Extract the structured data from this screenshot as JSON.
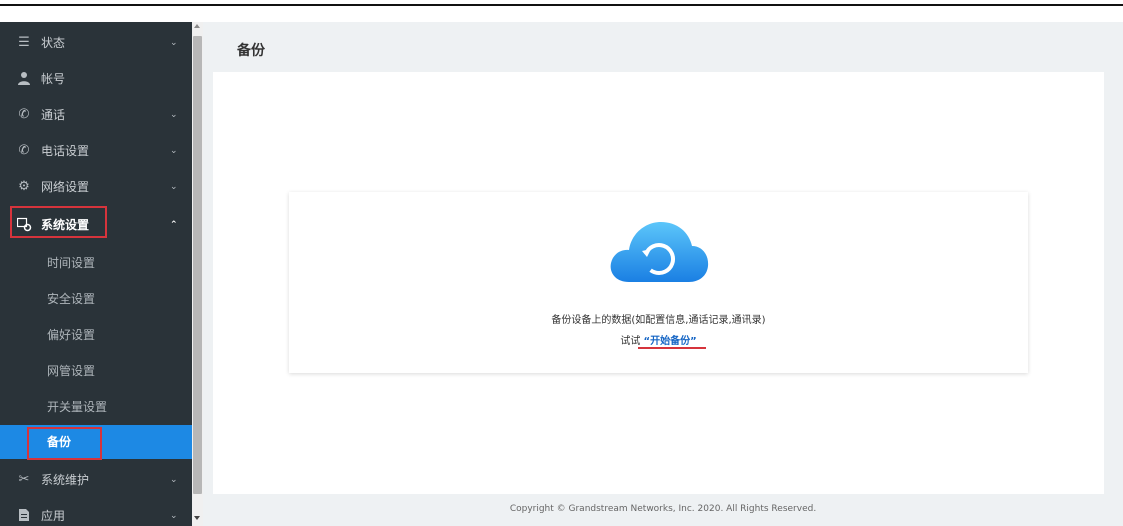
{
  "sidebar": {
    "items": [
      {
        "label": "状态",
        "icon": "list-icon",
        "chevron": "⌄"
      },
      {
        "label": "帐号",
        "icon": "user-icon",
        "chevron": ""
      },
      {
        "label": "通话",
        "icon": "phone-ringing-icon",
        "chevron": "⌄"
      },
      {
        "label": "电话设置",
        "icon": "phone-icon",
        "chevron": "⌄"
      },
      {
        "label": "网络设置",
        "icon": "network-icon",
        "chevron": "⌄"
      },
      {
        "label": "系统设置",
        "icon": "system-settings-icon",
        "chevron": "⌃"
      }
    ],
    "sub_items": [
      "时间设置",
      "安全设置",
      "偏好设置",
      "网管设置",
      "开关量设置",
      "备份"
    ],
    "after_items": [
      {
        "label": "系统维护",
        "icon": "tools-icon",
        "chevron": "⌄"
      },
      {
        "label": "应用",
        "icon": "document-icon",
        "chevron": "⌄"
      }
    ]
  },
  "main": {
    "title": "备份",
    "description": "备份设备上的数据(如配置信息,通话记录,通讯录)",
    "try_prefix": "试试",
    "try_link": "“开始备份”"
  },
  "footer": {
    "copyright": "Copyright © Grandstream Networks, Inc. 2020. All Rights Reserved."
  },
  "colors": {
    "sidebar_bg": "#2a3339",
    "active": "#1d89e4",
    "highlight": "#d6343c",
    "link": "#1666c5"
  }
}
